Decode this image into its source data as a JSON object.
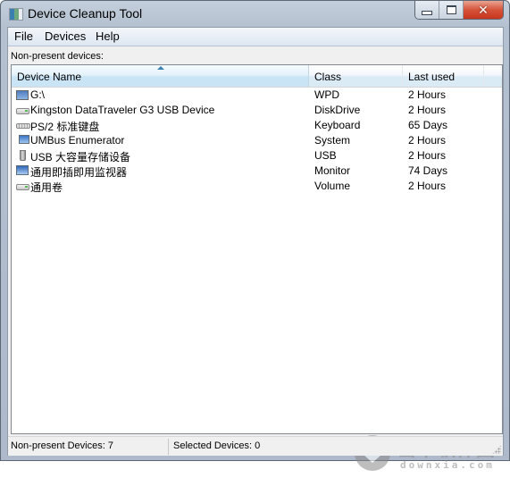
{
  "window": {
    "title": "Device Cleanup Tool",
    "controls": {
      "minimize": "minimize",
      "maximize": "maximize",
      "close": "✕"
    }
  },
  "menu": [
    "File",
    "Devices",
    "Help"
  ],
  "section_label": "Non-present devices:",
  "list": {
    "columns": [
      "Device Name",
      "Class",
      "Last used"
    ],
    "sorted_column": "Device Name",
    "sort_direction": "ascending",
    "rows": [
      {
        "icon": "wpd-icon",
        "name": "G:\\",
        "class": "WPD",
        "last_used": "2 Hours"
      },
      {
        "icon": "disk-drive-icon",
        "name": "Kingston DataTraveler G3 USB Device",
        "class": "DiskDrive",
        "last_used": "2 Hours"
      },
      {
        "icon": "keyboard-icon",
        "name": "PS/2 标准键盘",
        "class": "Keyboard",
        "last_used": "65 Days"
      },
      {
        "icon": "system-icon",
        "name": "UMBus Enumerator",
        "class": "System",
        "last_used": "2 Hours"
      },
      {
        "icon": "usb-icon",
        "name": "USB 大容量存储设备",
        "class": "USB",
        "last_used": "2 Hours"
      },
      {
        "icon": "monitor-icon",
        "name": "通用即插即用监视器",
        "class": "Monitor",
        "last_used": "74 Days"
      },
      {
        "icon": "volume-icon",
        "name": "通用卷",
        "class": "Volume",
        "last_used": "2 Hours"
      }
    ]
  },
  "status": {
    "non_present": "Non-present Devices: 7",
    "selected": "Selected Devices: 0"
  },
  "watermark": {
    "cn": "当下软件园",
    "en": "downxia.com"
  }
}
